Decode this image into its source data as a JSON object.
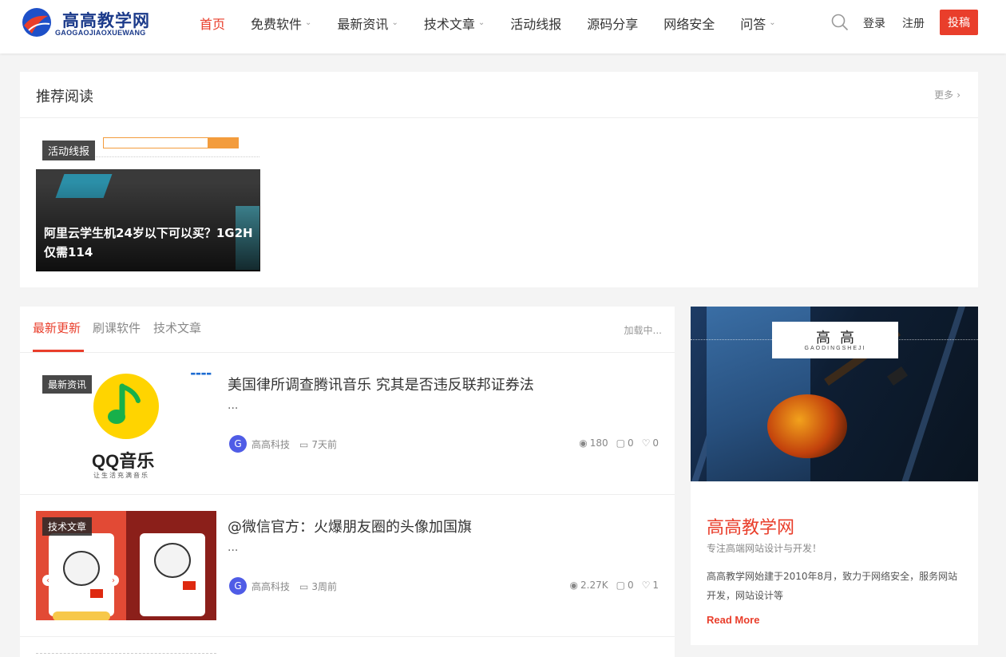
{
  "header": {
    "logo_title": "高高教学网",
    "logo_sub": "GAOGAOJIAOXUEWANG",
    "nav": [
      {
        "label": "首页",
        "active": true,
        "caret": false
      },
      {
        "label": "免费软件",
        "active": false,
        "caret": true
      },
      {
        "label": "最新资讯",
        "active": false,
        "caret": true
      },
      {
        "label": "技术文章",
        "active": false,
        "caret": true
      },
      {
        "label": "活动线报",
        "active": false,
        "caret": false
      },
      {
        "label": "源码分享",
        "active": false,
        "caret": false
      },
      {
        "label": "网络安全",
        "active": false,
        "caret": false
      },
      {
        "label": "问答",
        "active": false,
        "caret": true
      }
    ],
    "login_label": "登录",
    "register_label": "注册",
    "submit_label": "投稿",
    "search_icon": "search-icon"
  },
  "recommend": {
    "title": "推荐阅读",
    "more_label": "更多",
    "card": {
      "category": "活动线报",
      "title": "阿里云学生机24岁以下可以买？1G2H仅需114"
    }
  },
  "main": {
    "tabs": [
      {
        "label": "最新更新",
        "active": true
      },
      {
        "label": "刷课软件",
        "active": false
      },
      {
        "label": "技术文章",
        "active": false
      }
    ],
    "loading_label": "加载中...",
    "posts": [
      {
        "category": "最新资讯",
        "title": "美国律所调查腾讯音乐 究其是否违反联邦证券法",
        "excerpt": "...",
        "author_initial": "G",
        "author": "高高科技",
        "date": "7天前",
        "views": "180",
        "comments": "0",
        "likes": "0",
        "thumb_text": "QQ音乐",
        "thumb_sub": "让生活充满音乐"
      },
      {
        "category": "技术文章",
        "title": "@微信官方：火爆朋友圈的头像加国旗",
        "excerpt": "...",
        "author_initial": "G",
        "author": "高高科技",
        "date": "3周前",
        "views": "2.27K",
        "comments": "0",
        "likes": "1"
      }
    ]
  },
  "sidebar": {
    "brand_cn": "高高",
    "brand_en": "GAODINGSHEJI",
    "title": "高高教学网",
    "subtitle": "专注高端网站设计与开发！",
    "description": "高高教学网始建于2010年8月，致力于网络安全，服务网站开发，网站设计等",
    "read_more": "Read More"
  },
  "colors": {
    "accent": "#e93e2b",
    "brand_blue": "#1b3a8a",
    "avatar": "#4f5ce6"
  }
}
